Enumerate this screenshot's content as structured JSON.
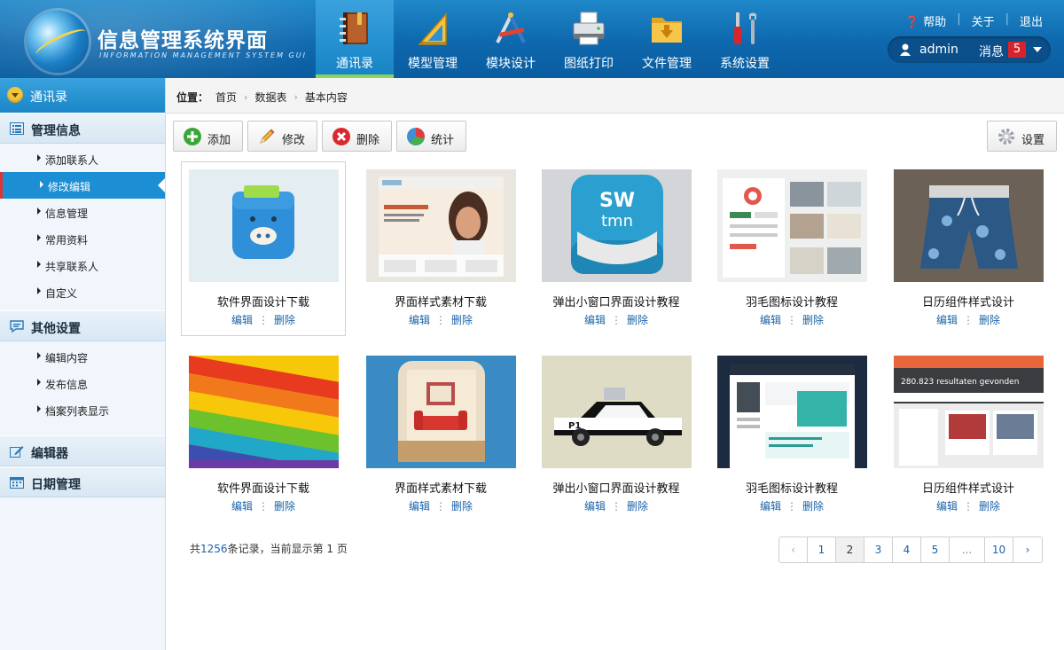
{
  "brand": {
    "title": "信息管理系统界面",
    "subtitle": "INFORMATION MANAGEMENT SYSTEM GUI"
  },
  "nav": [
    {
      "label": "通讯录",
      "icon": "address-book-icon"
    },
    {
      "label": "模型管理",
      "icon": "ruler-triangle-icon"
    },
    {
      "label": "模块设计",
      "icon": "design-tools-icon"
    },
    {
      "label": "图纸打印",
      "icon": "printer-icon"
    },
    {
      "label": "文件管理",
      "icon": "folder-icon"
    },
    {
      "label": "系统设置",
      "icon": "wrench-screwdriver-icon"
    }
  ],
  "top_links": {
    "help": "帮助",
    "about": "关于",
    "logout": "退出"
  },
  "user": {
    "name": "admin",
    "messages_label": "消息",
    "messages_count": "5"
  },
  "sidebar": {
    "top": "通讯录",
    "groups": [
      {
        "title": "管理信息",
        "items": [
          "添加联系人",
          "修改编辑",
          "信息管理",
          "常用资料",
          "共享联系人",
          "自定义"
        ]
      },
      {
        "title": "其他设置",
        "items": [
          "编辑内容",
          "发布信息",
          "档案列表显示"
        ]
      },
      {
        "title": "编辑器",
        "items": []
      },
      {
        "title": "日期管理",
        "items": []
      }
    ]
  },
  "breadcrumb": {
    "label": "位置：",
    "items": [
      "首页",
      "数据表",
      "基本内容"
    ]
  },
  "toolbar": {
    "add": "添加",
    "edit": "修改",
    "delete": "删除",
    "stats": "统计",
    "settings": "设置"
  },
  "cards": [
    {
      "title": "软件界面设计下载",
      "edit": "编辑",
      "delete": "删除"
    },
    {
      "title": "界面样式素材下载",
      "edit": "编辑",
      "delete": "删除"
    },
    {
      "title": "弹出小窗口界面设计教程",
      "edit": "编辑",
      "delete": "删除"
    },
    {
      "title": "羽毛图标设计教程",
      "edit": "编辑",
      "delete": "删除"
    },
    {
      "title": "日历组件样式设计",
      "edit": "编辑",
      "delete": "删除"
    },
    {
      "title": "软件界面设计下载",
      "edit": "编辑",
      "delete": "删除"
    },
    {
      "title": "界面样式素材下载",
      "edit": "编辑",
      "delete": "删除"
    },
    {
      "title": "弹出小窗口界面设计教程",
      "edit": "编辑",
      "delete": "删除"
    },
    {
      "title": "羽毛图标设计教程",
      "edit": "编辑",
      "delete": "删除"
    },
    {
      "title": "日历组件样式设计",
      "edit": "编辑",
      "delete": "删除"
    }
  ],
  "thumb_texts": {
    "sw": "SW",
    "tmn": "tmn",
    "p1": "P1",
    "results": "280.823 resultaten gevonden"
  },
  "summary": {
    "prefix": "共",
    "count": "1256",
    "suffix": "条记录，当前显示第 1 页"
  },
  "pager": {
    "prev": "‹",
    "pages": [
      "1",
      "2",
      "3",
      "4",
      "5",
      "...",
      "10"
    ],
    "current": "2",
    "next": "›"
  }
}
